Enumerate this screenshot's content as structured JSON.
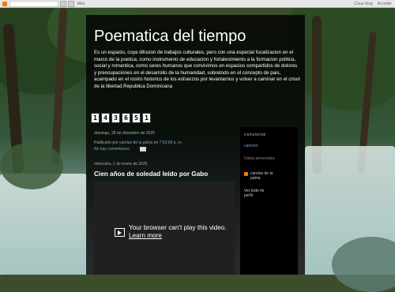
{
  "navbar": {
    "more_label": "Más",
    "right_links": [
      "Crear blog",
      "Acceder"
    ]
  },
  "blog": {
    "title": "Poematica del tiempo",
    "description": "Es un espacio, cuya difusion de trabajos culturales, pero con una especial focalizacion en el marco de la poetica, como instrumento de educacion y fortalecimiento a la formacion politica, social y romantica, como seres humanos que convivimos en espacios compartidos de dolores y preocupaciones en el desarrollo de la humanidad, sobretodo en el concepto de pais, acampado en el rostro historico de los esfuerzos por levantarnos y volver a caminar en el crisol de la libertad.Republica Dominicana"
  },
  "counter": {
    "digits": [
      "1",
      "4",
      "3",
      "6",
      "5",
      "1"
    ]
  },
  "posts": {
    "post1_date": "domingo, 28 de diciembre de 2025",
    "post1_published_prefix": "Publicado por",
    "post1_author": "carelas de la patria",
    "post1_on": "en",
    "post1_time": "7:53:00 p. m.",
    "post1_comments": "No hay comentarios:",
    "post2_date": "miércoles, 1 de enero de 2025",
    "post2_title": "Cien años de soledad leído por Gabo",
    "video_message": "Your browser can't play this video.",
    "video_learn_more": "Learn more"
  },
  "sidebar": {
    "link1": "instrumental",
    "link2": "cancion",
    "datos_label": "Datos personales",
    "profile_name": "carelas de la patria",
    "profile_link": "Ver todo mi perfil"
  }
}
